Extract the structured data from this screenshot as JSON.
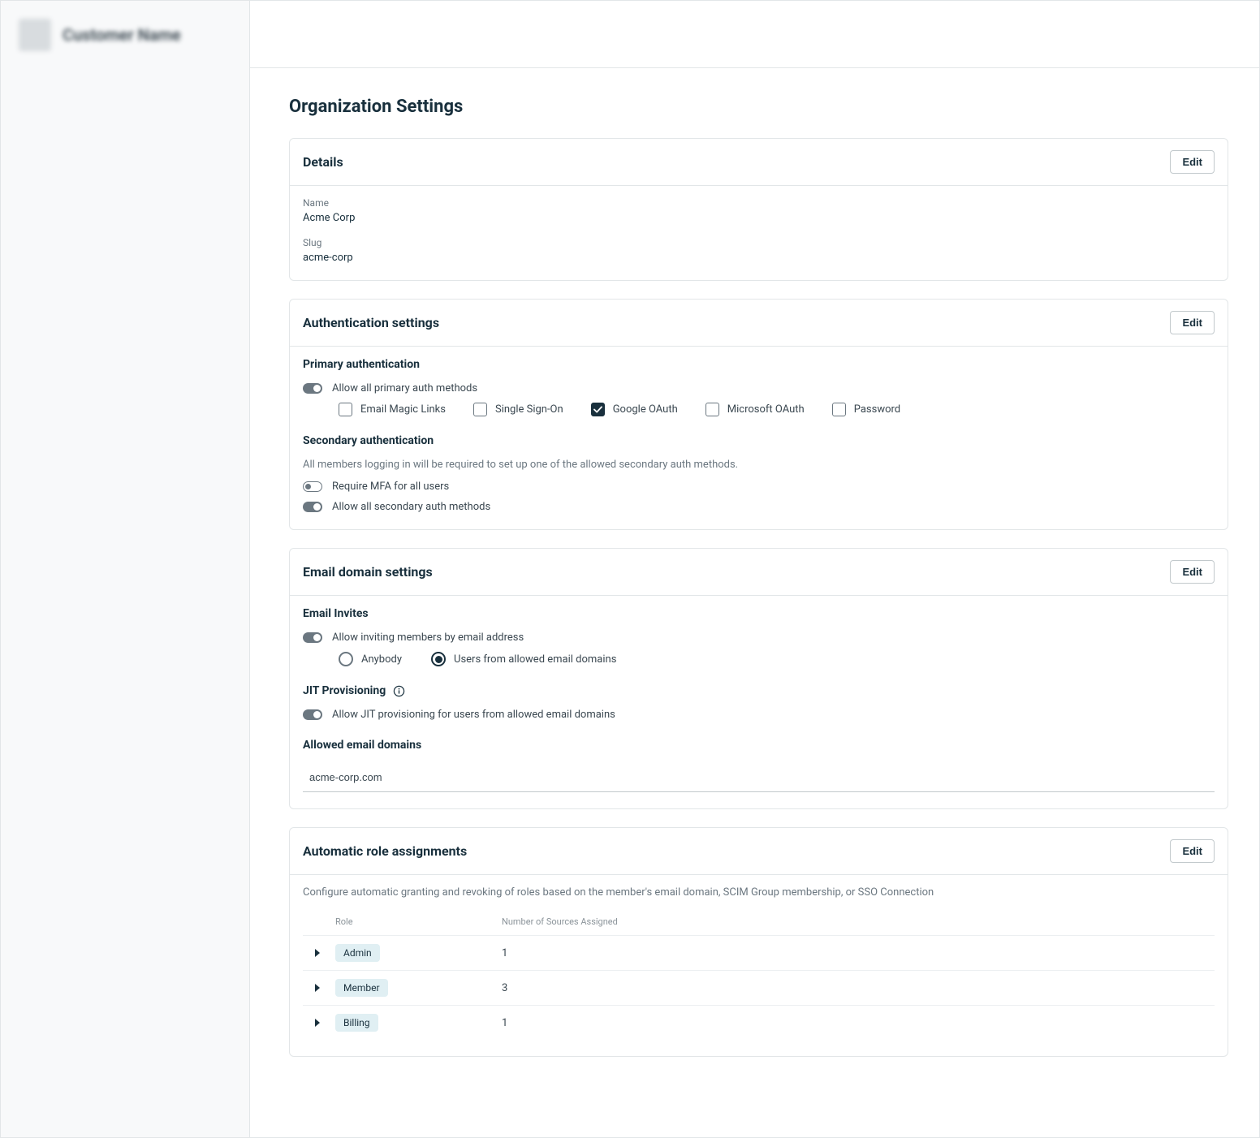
{
  "sidebar": {
    "customer_name": "Customer Name"
  },
  "page_title": "Organization Settings",
  "details": {
    "title": "Details",
    "edit": "Edit",
    "name_label": "Name",
    "name_value": "Acme Corp",
    "slug_label": "Slug",
    "slug_value": "acme-corp"
  },
  "auth": {
    "title": "Authentication settings",
    "edit": "Edit",
    "primary_heading": "Primary authentication",
    "allow_all_primary": "Allow all primary auth methods",
    "allow_all_primary_on": true,
    "methods": [
      {
        "label": "Email Magic Links",
        "checked": false
      },
      {
        "label": "Single Sign-On",
        "checked": false
      },
      {
        "label": "Google OAuth",
        "checked": true
      },
      {
        "label": "Microsoft OAuth",
        "checked": false
      },
      {
        "label": "Password",
        "checked": false
      }
    ],
    "secondary_heading": "Secondary authentication",
    "secondary_hint": "All members logging in will be required to set up one of the allowed secondary auth methods.",
    "require_mfa": "Require MFA for all users",
    "require_mfa_on": false,
    "allow_all_secondary": "Allow all secondary auth methods",
    "allow_all_secondary_on": true
  },
  "email_domain": {
    "title": "Email domain settings",
    "edit": "Edit",
    "invites_heading": "Email Invites",
    "allow_invites": "Allow inviting members by email address",
    "allow_invites_on": true,
    "radio_options": [
      {
        "label": "Anybody",
        "checked": false
      },
      {
        "label": "Users from allowed email domains",
        "checked": true
      }
    ],
    "jit_heading": "JIT Provisioning",
    "allow_jit": "Allow JIT provisioning for users from allowed email domains",
    "allow_jit_on": true,
    "allowed_domains_heading": "Allowed email domains",
    "domain_value": "acme-corp.com"
  },
  "roles": {
    "title": "Automatic role assignments",
    "edit": "Edit",
    "hint": "Configure automatic granting and revoking of roles based on the member's email domain, SCIM Group membership, or SSO Connection",
    "col_role": "Role",
    "col_sources": "Number of Sources Assigned",
    "rows": [
      {
        "role": "Admin",
        "count": "1"
      },
      {
        "role": "Member",
        "count": "3"
      },
      {
        "role": "Billing",
        "count": "1"
      }
    ]
  }
}
